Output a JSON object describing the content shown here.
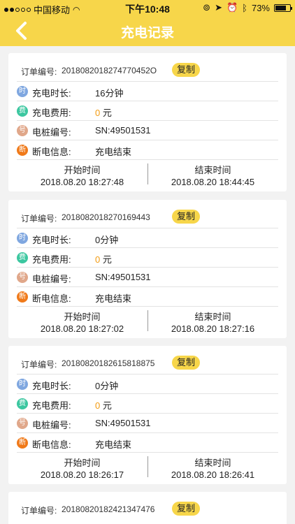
{
  "status_bar": {
    "carrier": "中国移动",
    "time": "下午10:48",
    "battery": "73%",
    "battery_level": 0.73
  },
  "nav": {
    "title": "充电记录"
  },
  "labels": {
    "order": "订单编号:",
    "copy": "复制",
    "duration": "充电时长:",
    "fee": "充电费用:",
    "pile": "电桩编号:",
    "disconnect": "断电信息:",
    "start": "开始时间",
    "end": "结束时间",
    "yuan": "元"
  },
  "icons": {
    "duration": {
      "char": "时",
      "color": "#7fa7e0"
    },
    "fee": {
      "char": "费",
      "color": "#3cc7a0"
    },
    "pile": {
      "char": "号",
      "color": "#e0a78a"
    },
    "disconnect": {
      "char": "断",
      "color": "#f07a1a"
    }
  },
  "records": [
    {
      "order_no": "2018082018274770452O",
      "duration": "16分钟",
      "fee": "0",
      "pile": "SN:49501531",
      "disconnect": "充电结束",
      "start": "2018.08.20 18:27:48",
      "end": "2018.08.20 18:44:45"
    },
    {
      "order_no": "2018082018270169443",
      "duration": "0分钟",
      "fee": "0",
      "pile": "SN:49501531",
      "disconnect": "充电结束",
      "start": "2018.08.20 18:27:02",
      "end": "2018.08.20 18:27:16"
    },
    {
      "order_no": "2018082018261581887​5",
      "duration": "0分钟",
      "fee": "0",
      "pile": "SN:49501531",
      "disconnect": "充电结束",
      "start": "2018.08.20 18:26:17",
      "end": "2018.08.20 18:26:41"
    },
    {
      "order_no": "2018082018242134747​6"
    }
  ]
}
